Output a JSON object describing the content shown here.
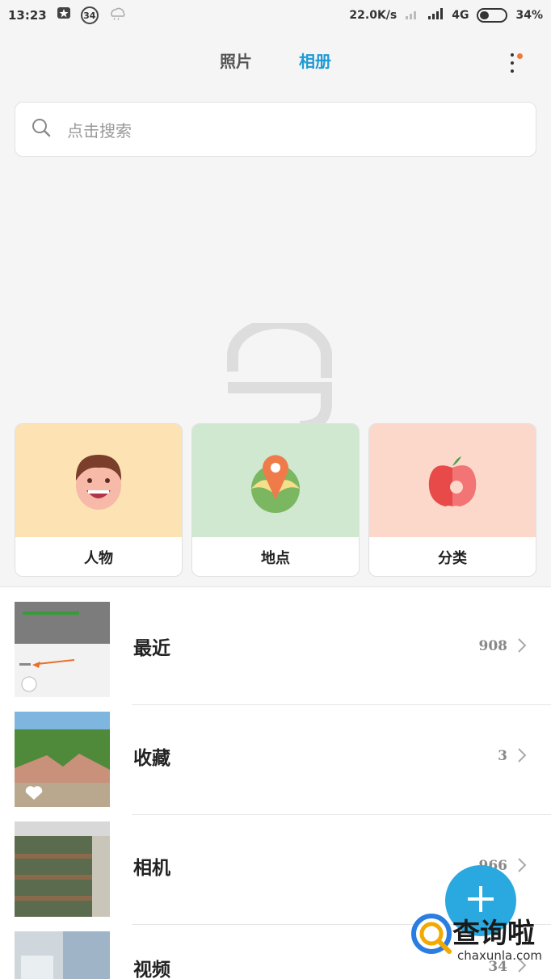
{
  "status_bar": {
    "time": "13:23",
    "notification_count": "34",
    "net_speed": "22.0K/s",
    "network": "4G",
    "battery": "34%"
  },
  "tabs": [
    {
      "label": "照片",
      "active": false
    },
    {
      "label": "相册",
      "active": true
    }
  ],
  "search": {
    "placeholder": "点击搜索"
  },
  "categories": [
    {
      "label": "人物",
      "bg": "#fde2b3",
      "icon": "face-icon"
    },
    {
      "label": "地点",
      "bg": "#cfe8cf",
      "icon": "location-icon"
    },
    {
      "label": "分类",
      "bg": "#fcd8cb",
      "icon": "apple-icon"
    }
  ],
  "albums": [
    {
      "name": "最近",
      "count": "908"
    },
    {
      "name": "收藏",
      "count": "3"
    },
    {
      "name": "相机",
      "count": "966"
    },
    {
      "name": "视频",
      "count": "34"
    }
  ],
  "watermark": {
    "text": "查询啦",
    "url": "chaxunla.com"
  },
  "colors": {
    "accent": "#1e9ad6",
    "fab": "#2aa9e0",
    "dot": "#f07a3c"
  }
}
